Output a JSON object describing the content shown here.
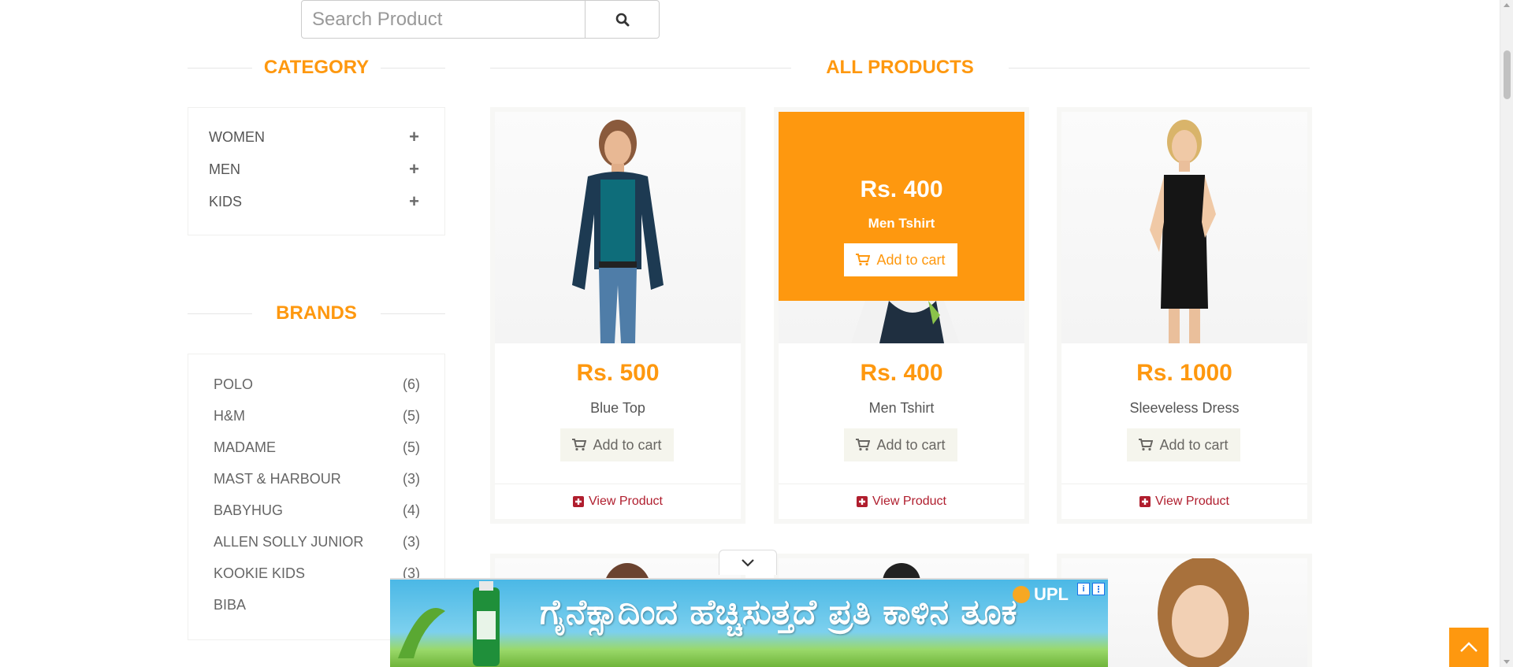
{
  "search": {
    "placeholder": "Search Product",
    "icon": "search-icon"
  },
  "sidebar": {
    "category_title": "CATEGORY",
    "categories": [
      {
        "label": "WOMEN",
        "icon": "plus-icon"
      },
      {
        "label": "MEN",
        "icon": "plus-icon"
      },
      {
        "label": "KIDS",
        "icon": "plus-icon"
      }
    ],
    "brands_title": "BRANDS",
    "brands": [
      {
        "name": "POLO",
        "count": "(6)"
      },
      {
        "name": "H&M",
        "count": "(5)"
      },
      {
        "name": "MADAME",
        "count": "(5)"
      },
      {
        "name": "MAST & HARBOUR",
        "count": "(3)"
      },
      {
        "name": "BABYHUG",
        "count": "(4)"
      },
      {
        "name": "ALLEN SOLLY JUNIOR",
        "count": "(3)"
      },
      {
        "name": "KOOKIE KIDS",
        "count": "(3)"
      },
      {
        "name": "BIBA",
        "count": ""
      }
    ]
  },
  "main": {
    "title": "ALL PRODUCTS",
    "products": [
      {
        "price": "Rs. 500",
        "name": "Blue Top",
        "cart_label": "Add to cart",
        "view_label": "View Product"
      },
      {
        "price": "Rs. 400",
        "name": "Men Tshirt",
        "cart_label": "Add to cart",
        "view_label": "View Product",
        "overlay": {
          "price": "Rs. 400",
          "name": "Men Tshirt",
          "cart_label": "Add to cart"
        }
      },
      {
        "price": "Rs. 1000",
        "name": "Sleeveless Dress",
        "cart_label": "Add to cart",
        "view_label": "View Product"
      }
    ]
  },
  "ad": {
    "text": "ಗೈನೆಕ್ಸಾದಿಂದ ಹೆಚ್ಚಿಸುತ್ತದೆ ಪ್ರತಿ ಕಾಳಿನ ತೂಕ",
    "brand": "UPL",
    "info_icon": "i",
    "menu_icon": "⋮"
  },
  "colors": {
    "accent": "#fe980f",
    "link": "#b01e2e",
    "text": "#555555"
  }
}
